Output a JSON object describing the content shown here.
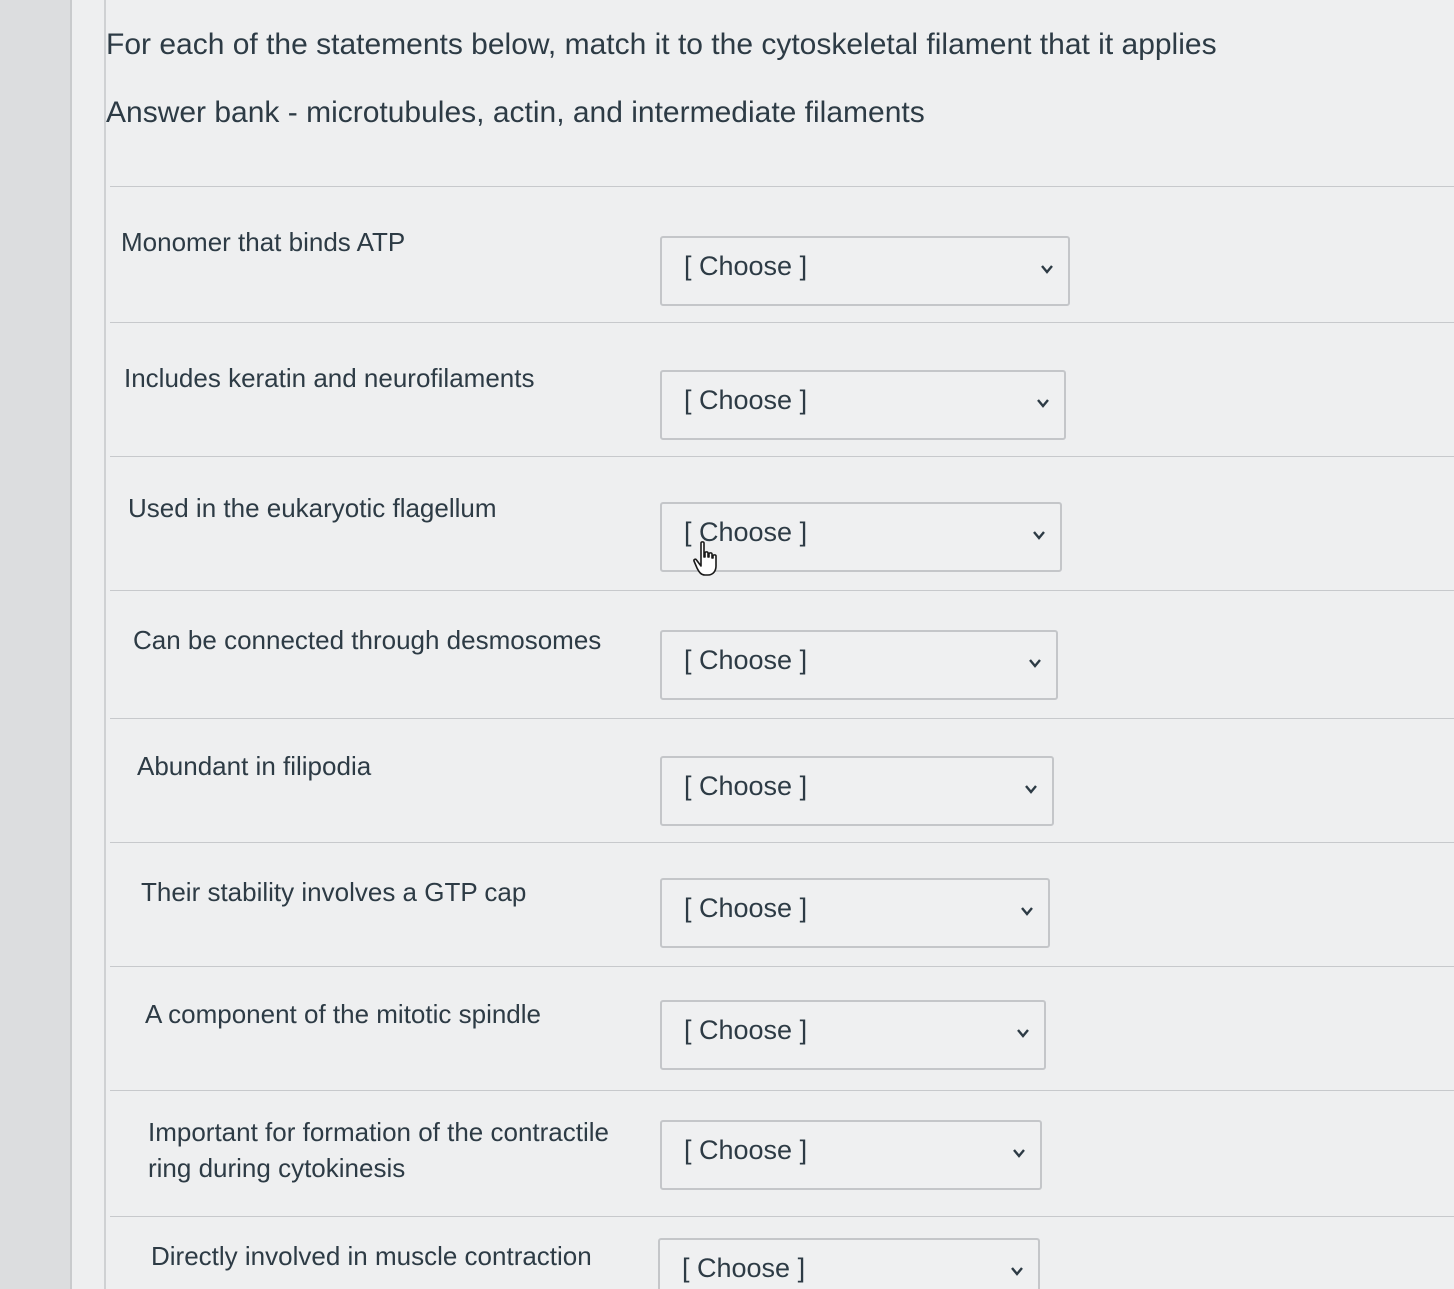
{
  "instructions": "For each of the statements below, match it to the cytoskeletal filament that it applies",
  "answer_bank": "Answer bank - microtubules, actin, and intermediate filaments",
  "rows": [
    {
      "label": "Monomer that binds ATP",
      "selected": "[ Choose ]"
    },
    {
      "label": "Includes keratin and neurofilaments",
      "selected": "[ Choose ]"
    },
    {
      "label": "Used in the eukaryotic flagellum",
      "selected": "[ Choose ]"
    },
    {
      "label": "Can be connected through desmosomes",
      "selected": "[ Choose ]"
    },
    {
      "label": "Abundant in filipodia",
      "selected": "[ Choose ]"
    },
    {
      "label": "Their stability involves a GTP cap",
      "selected": "[ Choose ]"
    },
    {
      "label": "A component of the mitotic spindle",
      "selected": "[ Choose ]"
    },
    {
      "label": "Important for formation of the contractile ring during cytokinesis",
      "selected": "[ Choose ]"
    },
    {
      "label": "Directly involved in muscle contraction",
      "selected": "[ Choose ]"
    }
  ],
  "icons": {
    "dropdown": "chevron-down-icon",
    "pointer": "hand-pointer-icon"
  }
}
